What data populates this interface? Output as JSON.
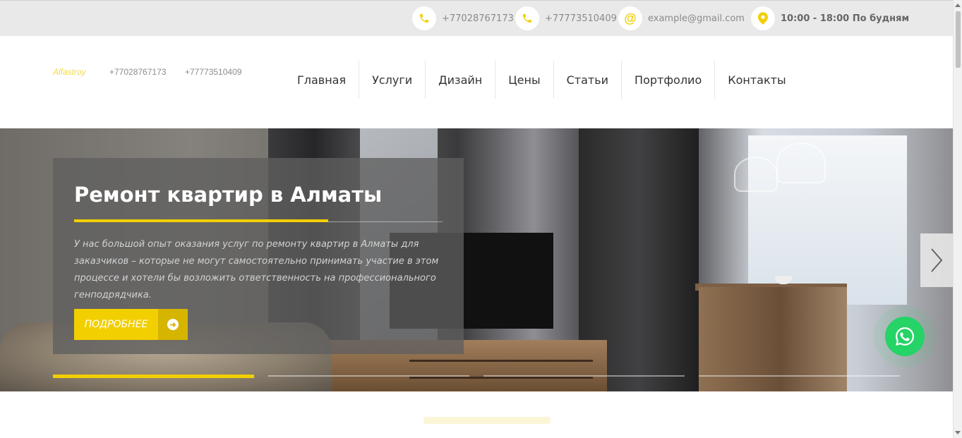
{
  "topbar": {
    "phone1": "+77028767173",
    "phone2": "+77773510409",
    "email": "example@gmail.com",
    "hours": "10:00 - 18:00 По будням"
  },
  "header": {
    "logo": "Alfastroy",
    "phone1": "+77028767173",
    "phone2": "+77773510409"
  },
  "nav": {
    "items": [
      "Главная",
      "Услуги",
      "Дизайн",
      "Цены",
      "Статьи",
      "Портфолио",
      "Контакты"
    ]
  },
  "hero": {
    "title": "Ремонт квартир в Алматы",
    "description": "У нас большой опыт оказания услуг по ремонту квартир в Алматы для заказчиков – которые не могут самостоятельно принимать участие в этом процессе и хотели бы возложить ответственность на профессионального генподрядчика.",
    "button_label": "ПОДРОБНЕЕ"
  },
  "slider": {
    "slide_count": 4,
    "active_index": 0
  },
  "icons": {
    "phone": "phone-icon",
    "email": "at-icon",
    "location": "location-pin-icon",
    "next": "chevron-right-icon",
    "whatsapp": "whatsapp-icon",
    "arrow": "arrow-right-circle-icon"
  },
  "colors": {
    "accent": "#f2cf00",
    "whatsapp": "#25d366"
  }
}
